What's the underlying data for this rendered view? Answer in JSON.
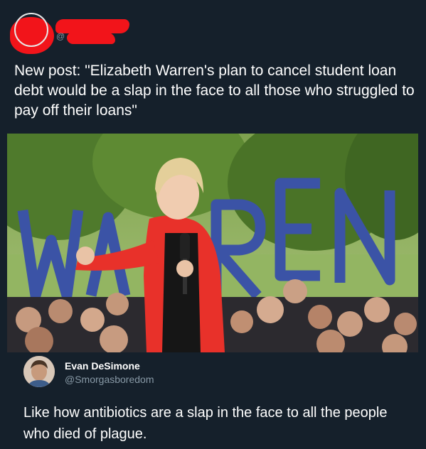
{
  "post": {
    "author_handle_prefix": "@",
    "text": "New post: \"Elizabeth Warren's plan to cancel student loan debt would be a slap in the face to all those who struggled to pay off their loans\"",
    "image": {
      "sign_letters": [
        "W",
        "A",
        "R",
        "R",
        "E",
        "N"
      ]
    }
  },
  "reply": {
    "name": "Evan DeSimone",
    "handle": "@Smorgasboredom",
    "text": "Like how antibiotics are a slap in the face to all the people who died of plague."
  },
  "colors": {
    "background": "#15202b",
    "redaction": "#f2141a",
    "secondary_text": "#8899a6",
    "jacket": "#e8312a",
    "sign_letters": "#3b53a6"
  }
}
